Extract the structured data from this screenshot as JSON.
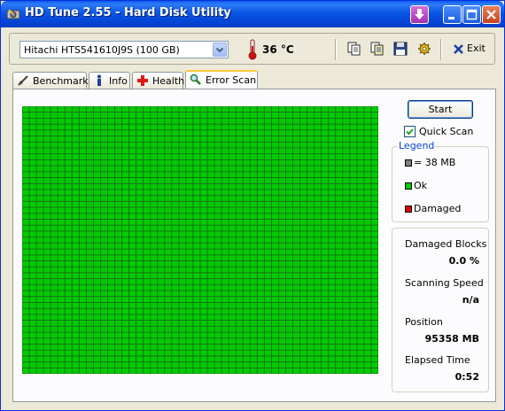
{
  "window": {
    "title": "HD Tune 2.55 - Hard Disk Utility"
  },
  "toolbar": {
    "drive": "Hitachi HTS541610J9S (100 GB)",
    "temperature": "36 °C",
    "exit_label": "Exit",
    "icons": [
      "copy-icon",
      "copy-text-icon",
      "save-icon",
      "options-icon",
      "exit-icon"
    ]
  },
  "tabs": [
    {
      "label": "Benchmark",
      "icon": "benchmark-icon",
      "active": false
    },
    {
      "label": "Info",
      "icon": "info-icon",
      "active": false
    },
    {
      "label": "Health",
      "icon": "health-cross-icon",
      "active": false
    },
    {
      "label": "Error Scan",
      "icon": "magnifier-icon",
      "active": true
    }
  ],
  "scan": {
    "start_label": "Start",
    "quick_scan_label": "Quick Scan",
    "quick_scan_checked": true,
    "block_color": "#00cc00",
    "block_border": "#1a6a1a",
    "grid_cols": 50,
    "grid_rows": 45,
    "damaged_blocks": 0
  },
  "legend": {
    "title": "Legend",
    "items": [
      {
        "label": "= 38 MB",
        "color": "#808080"
      },
      {
        "label": "Ok",
        "color": "#00cc00"
      },
      {
        "label": "Damaged",
        "color": "#e00000"
      }
    ]
  },
  "stats": {
    "damaged_blocks_label": "Damaged Blocks",
    "damaged_blocks_value": "0.0 %",
    "scanning_speed_label": "Scanning Speed",
    "scanning_speed_value": "n/a",
    "position_label": "Position",
    "position_value": "95358 MB",
    "elapsed_label": "Elapsed Time",
    "elapsed_value": "0:52"
  }
}
